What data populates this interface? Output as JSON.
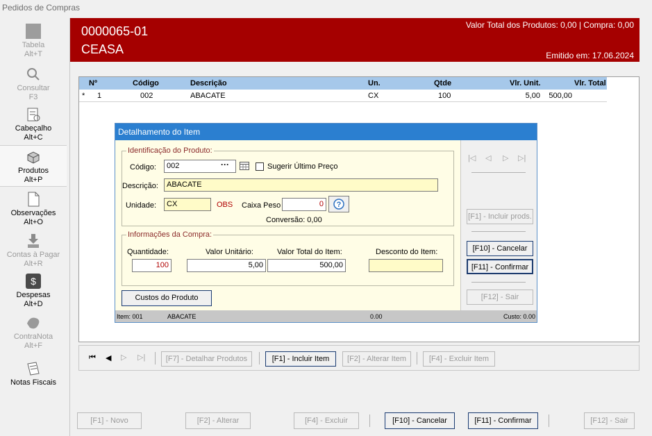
{
  "window": {
    "title": "Pedidos de Compras"
  },
  "sidebar": {
    "items": [
      {
        "label": "Tabela",
        "shortcut": "Alt+T",
        "icon": "table-icon",
        "enabled": false
      },
      {
        "label": "Consultar",
        "shortcut": "F3",
        "icon": "search-icon",
        "enabled": false
      },
      {
        "label": "Cabeçalho",
        "shortcut": "Alt+C",
        "icon": "header-icon",
        "enabled": true
      },
      {
        "label": "Produtos",
        "shortcut": "Alt+P",
        "icon": "products-icon",
        "enabled": true
      },
      {
        "label": "Observações",
        "shortcut": "Alt+O",
        "icon": "notes-icon",
        "enabled": true
      },
      {
        "label": "Contas à Pagar",
        "shortcut": "Alt+R",
        "icon": "payables-icon",
        "enabled": false
      },
      {
        "label": "Despesas",
        "shortcut": "Alt+D",
        "icon": "dollar-icon",
        "enabled": true
      },
      {
        "label": "ContraNota",
        "shortcut": "Alt+F",
        "icon": "counter-note-icon",
        "enabled": false
      },
      {
        "label": "Notas Fiscais",
        "shortcut": "",
        "icon": "invoices-icon",
        "enabled": true
      }
    ]
  },
  "header": {
    "order_number": "0000065-01",
    "supplier": "CEASA",
    "totals": "Valor Total dos Produtos: 0,00 | Compra: 0,00",
    "issued": "Emitido em: 17.06.2024",
    "accent_color": "#a50000"
  },
  "grid": {
    "columns": [
      "Nº",
      "Código",
      "Descrição",
      "Un.",
      "Qtde",
      "Vlr. Unit.",
      "Vlr. Total"
    ],
    "rows": [
      {
        "marker": "*",
        "num": "1",
        "code": "002",
        "description": "ABACATE",
        "unit": "CX",
        "qty": "100",
        "unit_value": "5,00",
        "total": "500,00"
      }
    ]
  },
  "grid_toolbar": {
    "detail": "[F7] - Detalhar Produtos",
    "include": "[F1] - Incluir Item",
    "alter": "[F2] - Alterar Item",
    "delete": "[F4] - Excluir  Item"
  },
  "dialog": {
    "title": "Detalhamento do Item",
    "product_group": "Identificação do Produto:",
    "code_label": "Código:",
    "code_value": "002",
    "suggest_label": "Sugerir Último Preço",
    "desc_label": "Descrição:",
    "desc_value": "ABACATE",
    "unit_label": "Unidade:",
    "unit_value": "CX",
    "obs_label": "OBS",
    "box_weight_label": "Caixa Peso",
    "box_weight_value": "0",
    "conversion": "Conversão: 0,00",
    "purchase_group": "Informações da Compra:",
    "qty_label": "Quantidade:",
    "qty_value": "100",
    "unit_price_label": "Valor Unitário:",
    "unit_price_value": "5,00",
    "total_label": "Valor Total do Item:",
    "total_value": "500,00",
    "discount_label": "Desconto do Item:",
    "discount_value": "",
    "costs_button": "Custos do Produto",
    "include_prods": "[F1] - Incluir prods.",
    "cancel": "[F10] - Cancelar",
    "confirm": "[F11] - Confirmar",
    "exit": "[F12] - Sair",
    "status": {
      "item": "Item: 001",
      "desc": "ABACATE",
      "value": "0.00",
      "cost": "Custo: 0.00"
    }
  },
  "footer": {
    "new": "[F1] - Novo",
    "alter": "[F2] - Alterar",
    "delete": "[F4] - Excluir",
    "cancel": "[F10] - Cancelar",
    "confirm": "[F11] - Confirmar",
    "exit": "[F12] - Sair"
  }
}
